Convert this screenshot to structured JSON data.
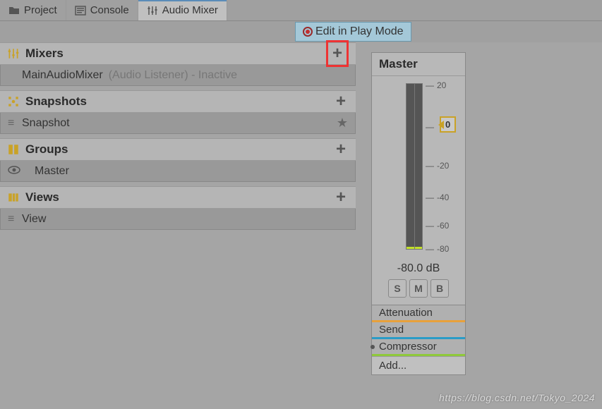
{
  "tabs": {
    "project": "Project",
    "console": "Console",
    "audio_mixer": "Audio Mixer"
  },
  "play_mode_label": "Edit in Play Mode",
  "sections": {
    "mixers": {
      "title": "Mixers",
      "item_name": "MainAudioMixer",
      "item_status": "(Audio Listener) - Inactive"
    },
    "snapshots": {
      "title": "Snapshots",
      "item_name": "Snapshot"
    },
    "groups": {
      "title": "Groups",
      "item_name": "Master"
    },
    "views": {
      "title": "Views",
      "item_name": "View"
    }
  },
  "strip": {
    "title": "Master",
    "db_label": "-80.0 dB",
    "solo": "S",
    "mute": "M",
    "bypass": "B",
    "zero": "0",
    "ticks": [
      "20",
      "0",
      "-20",
      "-40",
      "-60",
      "-80"
    ],
    "fx": {
      "atten": "Attenuation",
      "send": "Send",
      "comp": "Compressor"
    },
    "add": "Add..."
  },
  "watermark": "https://blog.csdn.net/Tokyo_2024"
}
